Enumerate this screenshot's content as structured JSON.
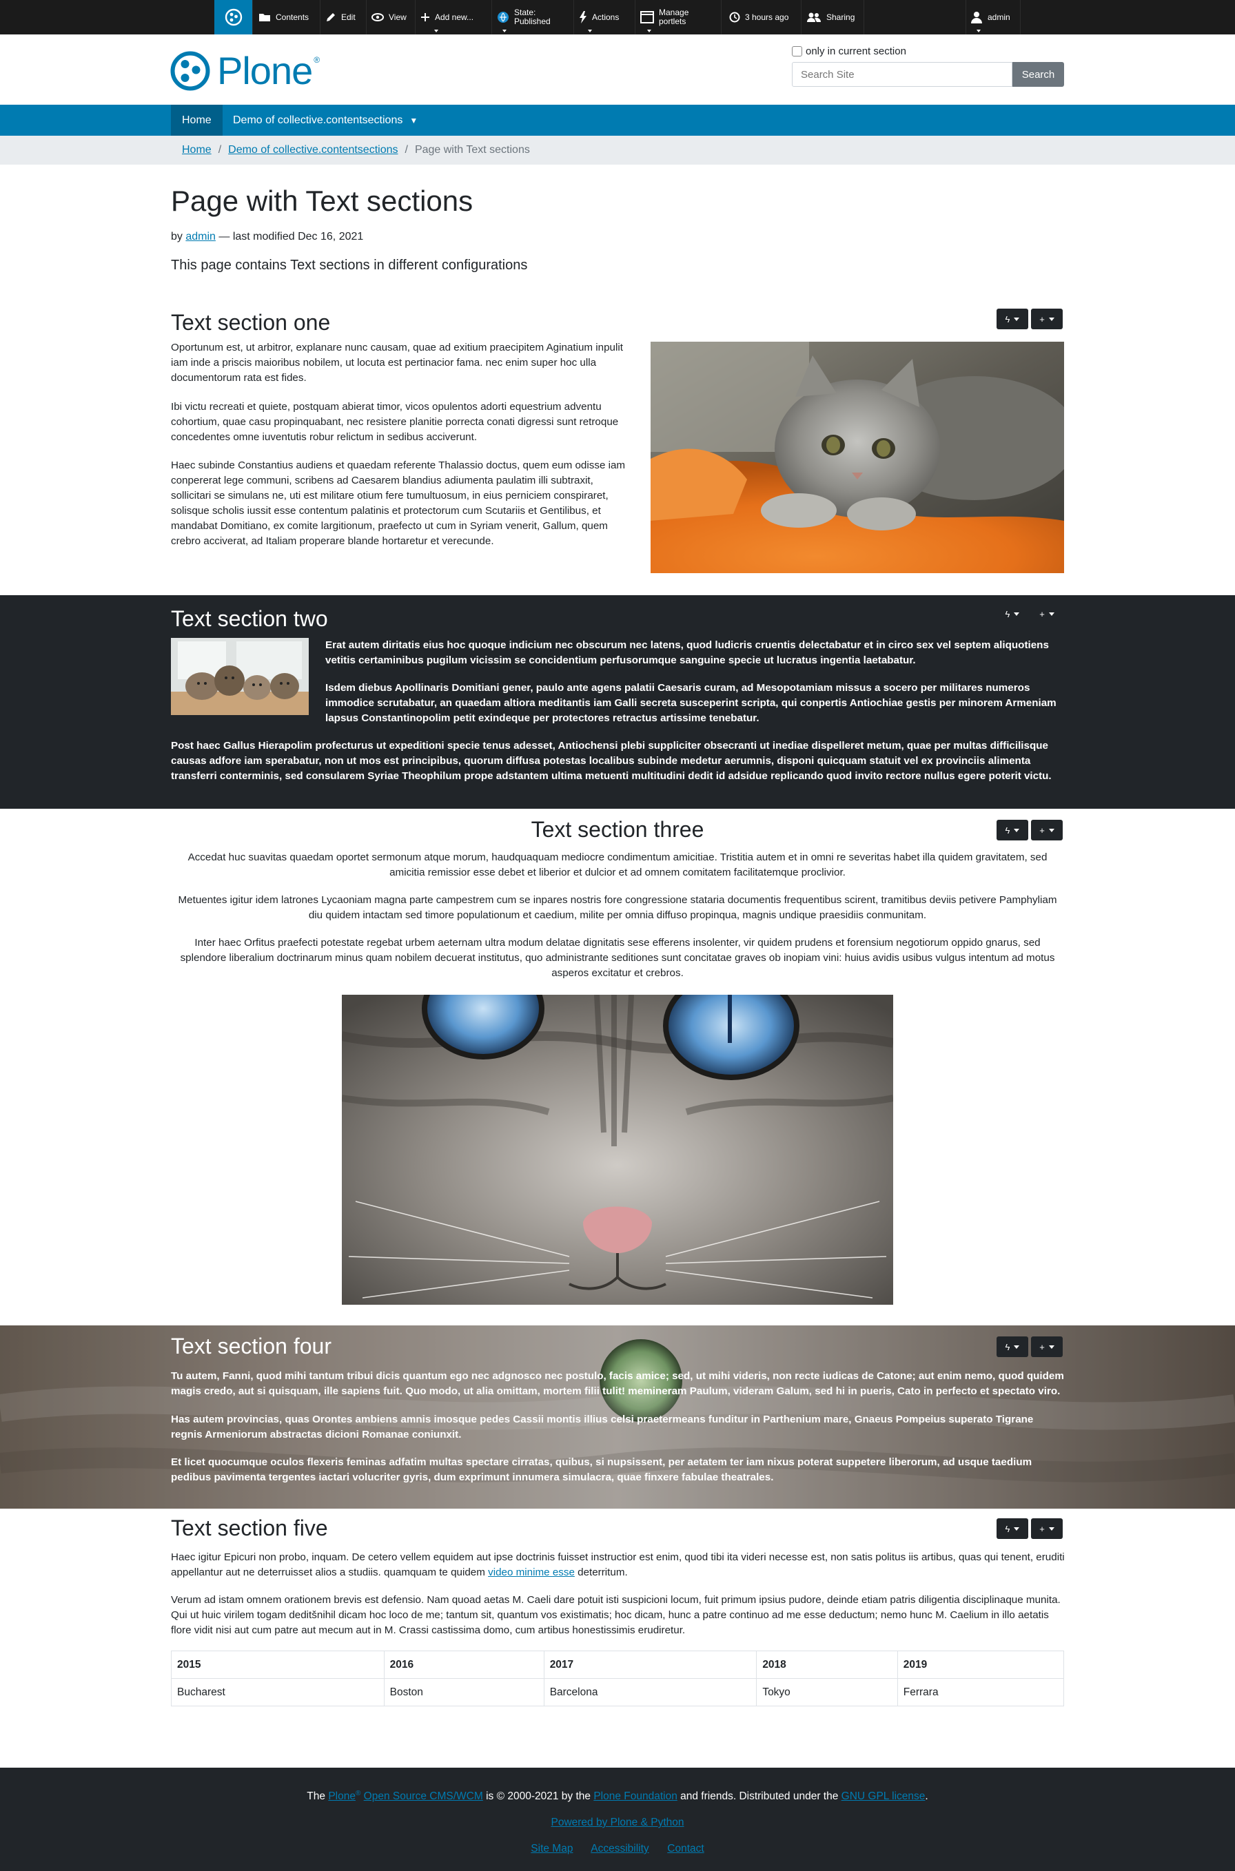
{
  "toolbar": {
    "items": [
      {
        "label": "Contents",
        "icon": "folder-icon"
      },
      {
        "label": "Edit",
        "icon": "pencil-icon"
      },
      {
        "label": "View",
        "icon": "eye-icon"
      },
      {
        "label": "Add new...",
        "icon": "plus-icon"
      },
      {
        "label": "State: Published",
        "line1": "State:",
        "line2": "Published",
        "icon": "state-icon"
      },
      {
        "label": "Actions",
        "icon": "lightning-icon"
      },
      {
        "label": "Manage portlets",
        "line1": "Manage",
        "line2": "portlets",
        "icon": "portlets-icon"
      },
      {
        "label": "3 hours ago",
        "icon": "clock-icon"
      },
      {
        "label": "Sharing",
        "icon": "sharing-icon"
      },
      {
        "label": "admin",
        "icon": "user-icon"
      }
    ]
  },
  "header": {
    "logo_text": "Plone",
    "logo_reg": "®",
    "search_checkbox_label": "only in current section",
    "search_placeholder": "Search Site",
    "search_button": "Search"
  },
  "nav": {
    "items": [
      "Home",
      "Demo of collective.contentsections"
    ]
  },
  "breadcrumbs": {
    "home": "Home",
    "parent": "Demo of collective.contentsections",
    "current": "Page with Text sections"
  },
  "page": {
    "title": "Page with Text sections",
    "by": "by",
    "author": "admin",
    "modified": "— last modified Dec 16, 2021",
    "description": "This page contains Text sections in different configurations"
  },
  "sections": {
    "one": {
      "title": "Text section one",
      "paras": [
        "Oportunum est, ut arbitror, explanare nunc causam, quae ad exitium praecipitem Aginatium inpulit iam inde a priscis maioribus nobilem, ut locuta est pertinacior fama. nec enim super hoc ulla documentorum rata est fides.",
        "Ibi victu recreati et quiete, postquam abierat timor, vicos opulentos adorti equestrium adventu cohortium, quae casu propinquabant, nec resistere planitie porrecta conati digressi sunt retroque concedentes omne iuventutis robur relictum in sedibus acciverunt.",
        "Haec subinde Constantius audiens et quaedam referente Thalassio doctus, quem eum odisse iam conpererat lege communi, scribens ad Caesarem blandius adiumenta paulatim illi subtraxit, sollicitari se simulans ne, uti est militare otium fere tumultuosum, in eius perniciem conspiraret, solisque scholis iussit esse contentum palatinis et protectorum cum Scutariis et Gentilibus, et mandabat Domitiano, ex comite largitionum, praefecto ut cum in Syriam venerit, Gallum, quem crebro acciverat, ad Italiam properare blande hortaretur et verecunde."
      ]
    },
    "two": {
      "title": "Text section two",
      "paras": [
        "Erat autem diritatis eius hoc quoque indicium nec obscurum nec latens, quod ludicris cruentis delectabatur et in circo sex vel septem aliquotiens vetitis certaminibus pugilum vicissim se concidentium perfusorumque sanguine specie ut lucratus ingentia laetabatur.",
        "Isdem diebus Apollinaris Domitiani gener, paulo ante agens palatii Caesaris curam, ad Mesopotamiam missus a socero per militares numeros immodice scrutabatur, an quaedam altiora meditantis iam Galli secreta susceperint scripta, qui conpertis Antiochiae gestis per minorem Armeniam lapsus Constantinopolim petit exindeque per protectores retractus artissime tenebatur.",
        "Post haec Gallus Hierapolim profecturus ut expeditioni specie tenus adesset, Antiochensi plebi suppliciter obsecranti ut inediae dispelleret metum, quae per multas difficilisque causas adfore iam sperabatur, non ut mos est principibus, quorum diffusa potestas localibus subinde medetur aerumnis, disponi quicquam statuit vel ex provinciis alimenta transferri conterminis, sed consularem Syriae Theophilum prope adstantem ultima metuenti multitudini dedit id adsidue replicando quod invito rectore nullus egere poterit victu."
      ]
    },
    "three": {
      "title": "Text section three",
      "paras": [
        "Accedat huc suavitas quaedam oportet sermonum atque morum, haudquaquam mediocre condimentum amicitiae. Tristitia autem et in omni re severitas habet illa quidem gravitatem, sed amicitia remissior esse debet et liberior et dulcior et ad omnem comitatem facilitatemque proclivior.",
        "Metuentes igitur idem latrones Lycaoniam magna parte campestrem cum se inpares nostris fore congressione stataria documentis frequentibus scirent, tramitibus deviis petivere Pamphyliam diu quidem intactam sed timore populationum et caedium, milite per omnia diffuso propinqua, magnis undique praesidiis conmunitam.",
        "Inter haec Orfitus praefecti potestate regebat urbem aeternam ultra modum delatae dignitatis sese efferens insolenter, vir quidem prudens et forensium negotiorum oppido gnarus, sed splendore liberalium doctrinarum minus quam nobilem decuerat institutus, quo administrante seditiones sunt concitatae graves ob inopiam vini: huius avidis usibus vulgus intentum ad motus asperos excitatur et crebros."
      ]
    },
    "four": {
      "title": "Text section four",
      "paras": [
        "Tu autem, Fanni, quod mihi tantum tribui dicis quantum ego nec adgnosco nec postulo, facis amice; sed, ut mihi videris, non recte iudicas de Catone; aut enim nemo, quod quidem magis credo, aut si quisquam, ille sapiens fuit. Quo modo, ut alia omittam, mortem filii tulit! memineram Paulum, videram Galum, sed hi in pueris, Cato in perfecto et spectato viro.",
        "Has autem provincias, quas Orontes ambiens amnis imosque pedes Cassii montis illius celsi praetermeans funditur in Parthenium mare, Gnaeus Pompeius superato Tigrane regnis Armeniorum abstractas dicioni Romanae coniunxit.",
        "Et licet quocumque oculos flexeris feminas adfatim multas spectare cirratas, quibus, si nupsissent, per aetatem ter iam nixus poterat suppetere liberorum, ad usque taedium pedibus pavimenta tergentes iactari volucriter gyris, dum exprimunt innumera simulacra, quae finxere fabulae theatrales."
      ]
    },
    "five": {
      "title": "Text section five",
      "para1_pre": "Haec igitur Epicuri non probo, inquam. De cetero vellem equidem aut ipse doctrinis fuisset instructior est enim, quod tibi ita videri necesse est, non satis politus iis artibus, quas qui tenent, eruditi appellantur aut ne deterruisset alios a studiis. quamquam te quidem ",
      "para1_link": "video minime esse",
      "para1_post": " deterritum.",
      "para2": "Verum ad istam omnem orationem brevis est defensio. Nam quoad aetas M. Caeli dare potuit isti suspicioni locum, fuit primum ipsius pudore, deinde etiam patris diligentia disciplinaque munita. Qui ut huic virilem togam deditšnihil dicam hoc loco de me; tantum sit, quantum vos existimatis; hoc dicam, hunc a patre continuo ad me esse deductum; nemo hunc M. Caelium in illo aetatis flore vidit nisi aut cum patre aut mecum aut in M. Crassi castissima domo, cum artibus honestissimis erudiretur.",
      "table": {
        "headers": [
          "2015",
          "2016",
          "2017",
          "2018",
          "2019"
        ],
        "rows": [
          [
            "Bucharest",
            "Boston",
            "Barcelona",
            "Tokyo",
            "Ferrara"
          ]
        ]
      }
    }
  },
  "controls": {
    "tile_icon": "ϟ",
    "add_icon": "+"
  },
  "footer": {
    "the": "The",
    "plone": "Plone",
    "reg": "®",
    "cms": "Open Source CMS/WCM",
    "copy": "is © 2000-2021 by the",
    "foundation": "Plone Foundation",
    "friends": "and friends. Distributed under the",
    "license": "GNU GPL license",
    "dot": ".",
    "powered": "Powered by Plone & Python",
    "links": [
      "Site Map",
      "Accessibility",
      "Contact"
    ]
  },
  "colors": {
    "brand": "#007bb1",
    "dark": "#212529",
    "toolbar": "#1b1b1b"
  }
}
